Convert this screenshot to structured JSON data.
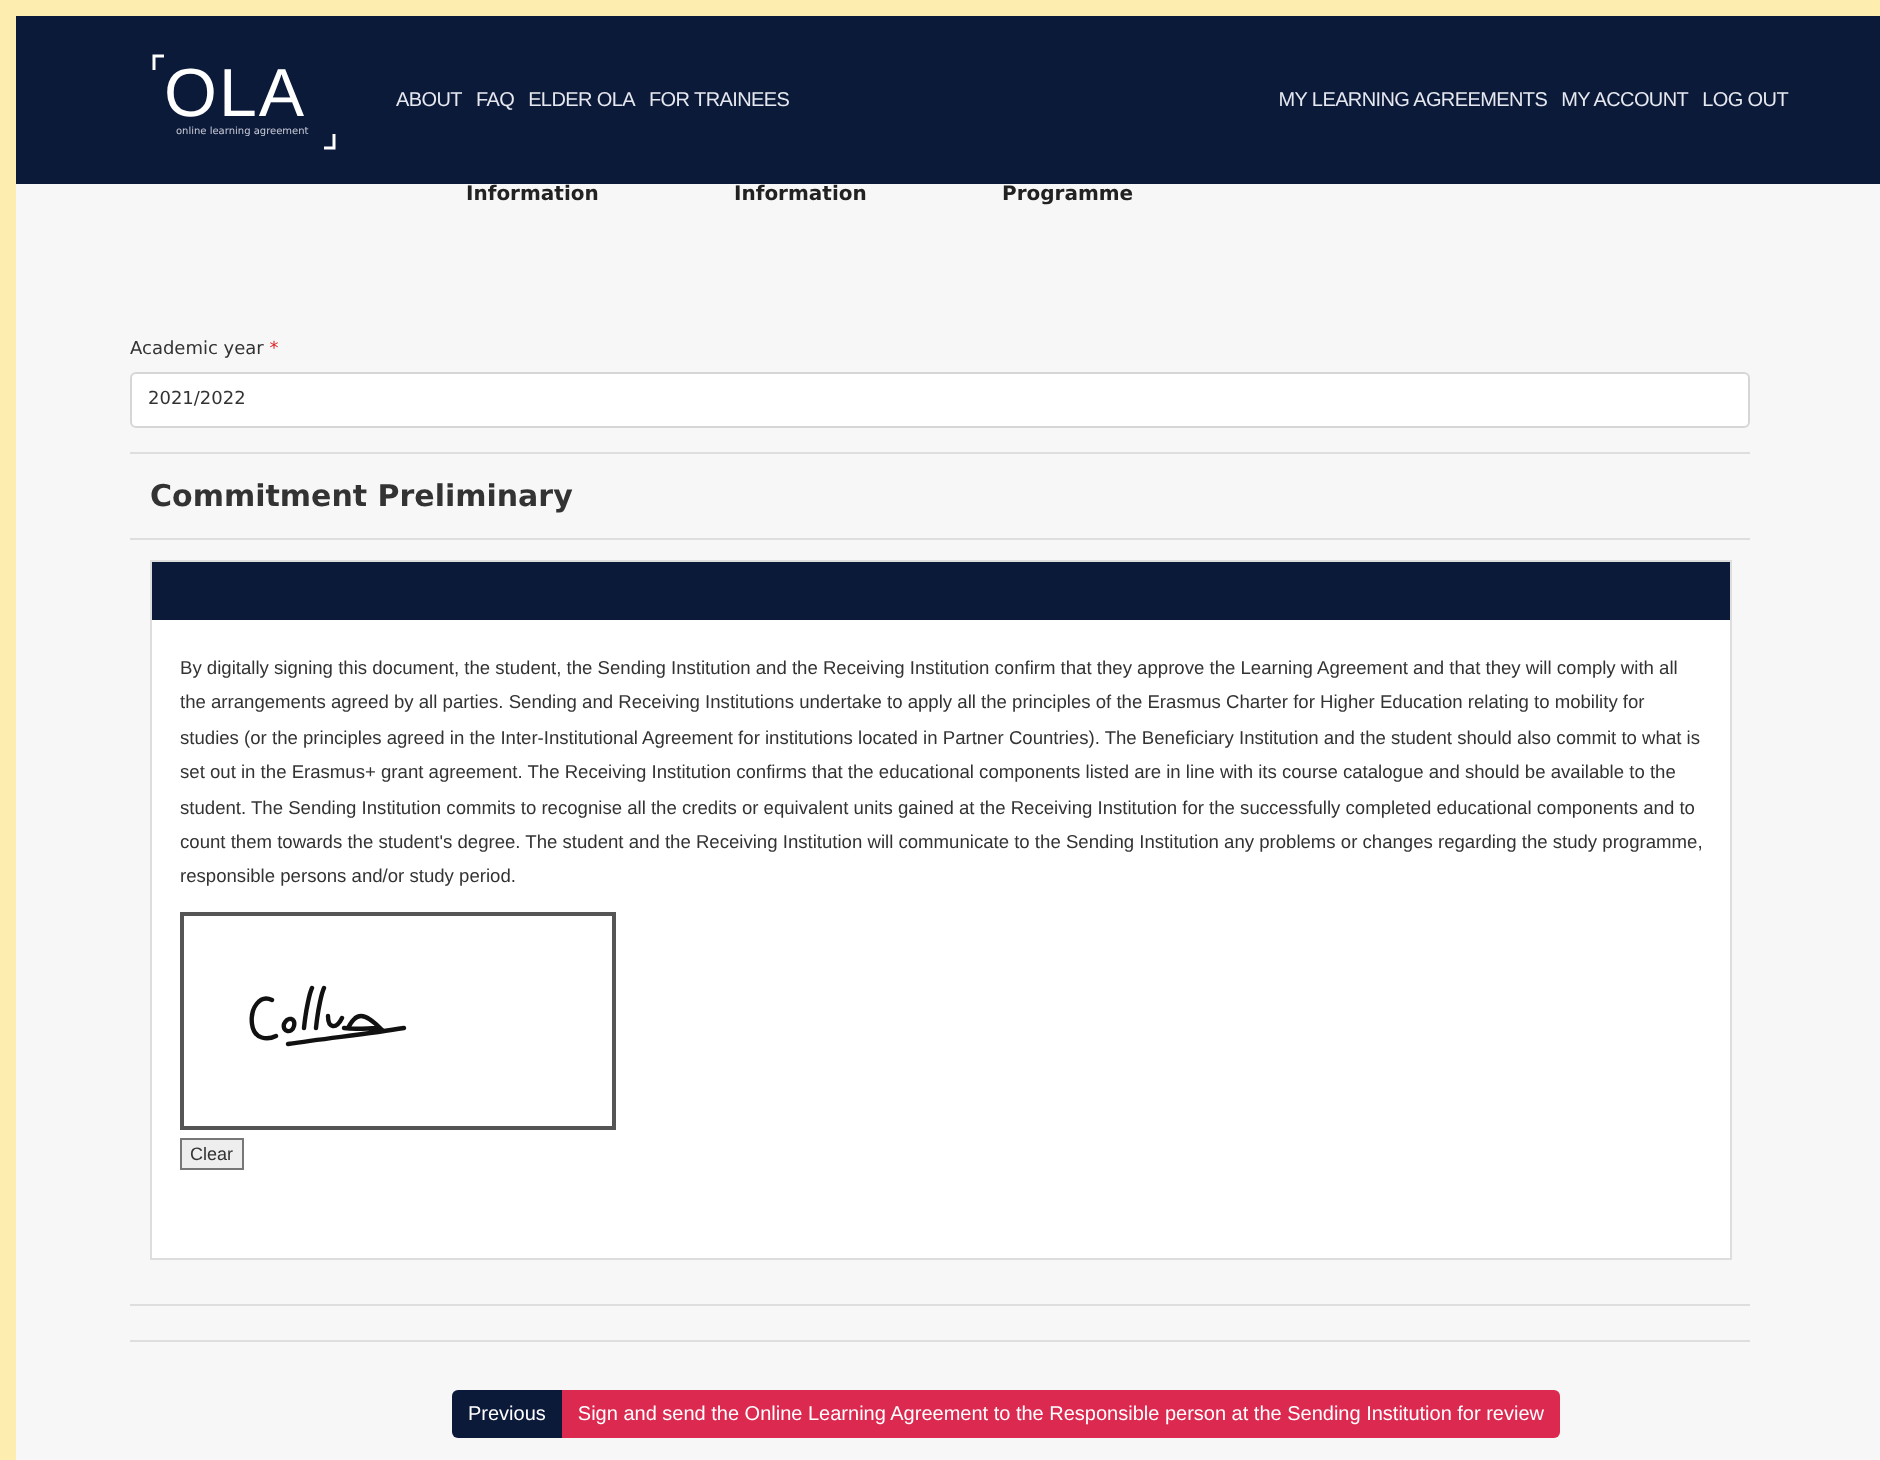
{
  "header": {
    "logo": {
      "title": "OLA",
      "tagline": "online learning agreement"
    },
    "nav_left": [
      "ABOUT",
      "FAQ",
      "ELDER OLA",
      "FOR TRAINEES"
    ],
    "nav_right": [
      "MY LEARNING AGREEMENTS",
      "MY ACCOUNT",
      "LOG OUT"
    ]
  },
  "steps": [
    "Information",
    "Information",
    "Programme"
  ],
  "academic_year": {
    "label": "Academic year",
    "required_mark": "*",
    "value": "2021/2022"
  },
  "section_title": "Commitment Preliminary",
  "commitment_text": "By digitally signing this document, the student, the Sending Institution and the Receiving Institution confirm that they approve the Learning Agreement and that they will comply with all the arrangements agreed by all parties. Sending and Receiving Institutions undertake to apply all the principles of the Erasmus Charter for Higher Education relating to mobility for studies (or the principles agreed in the Inter-Institutional Agreement for institutions located in Partner Countries). The Beneficiary Institution and the student should also commit to what is set out in the Erasmus+ grant agreement. The Receiving Institution confirms that the educational components listed are in line with its course catalogue and should be available to the student. The Sending Institution commits to recognise all the credits or equivalent units gained at the Receiving Institution for the successfully completed educational components and to count them towards the student's degree. The student and the Receiving Institution will communicate to the Sending Institution any problems or changes regarding the study programme, responsible persons and/or study period.",
  "clear_button": "Clear",
  "buttons": [
    {
      "label": "Previous",
      "kind": "secondary"
    },
    {
      "label": "Sign and send the Online Learning Agreement to the Responsible person at the Sending Institution for review",
      "kind": "primary"
    }
  ]
}
